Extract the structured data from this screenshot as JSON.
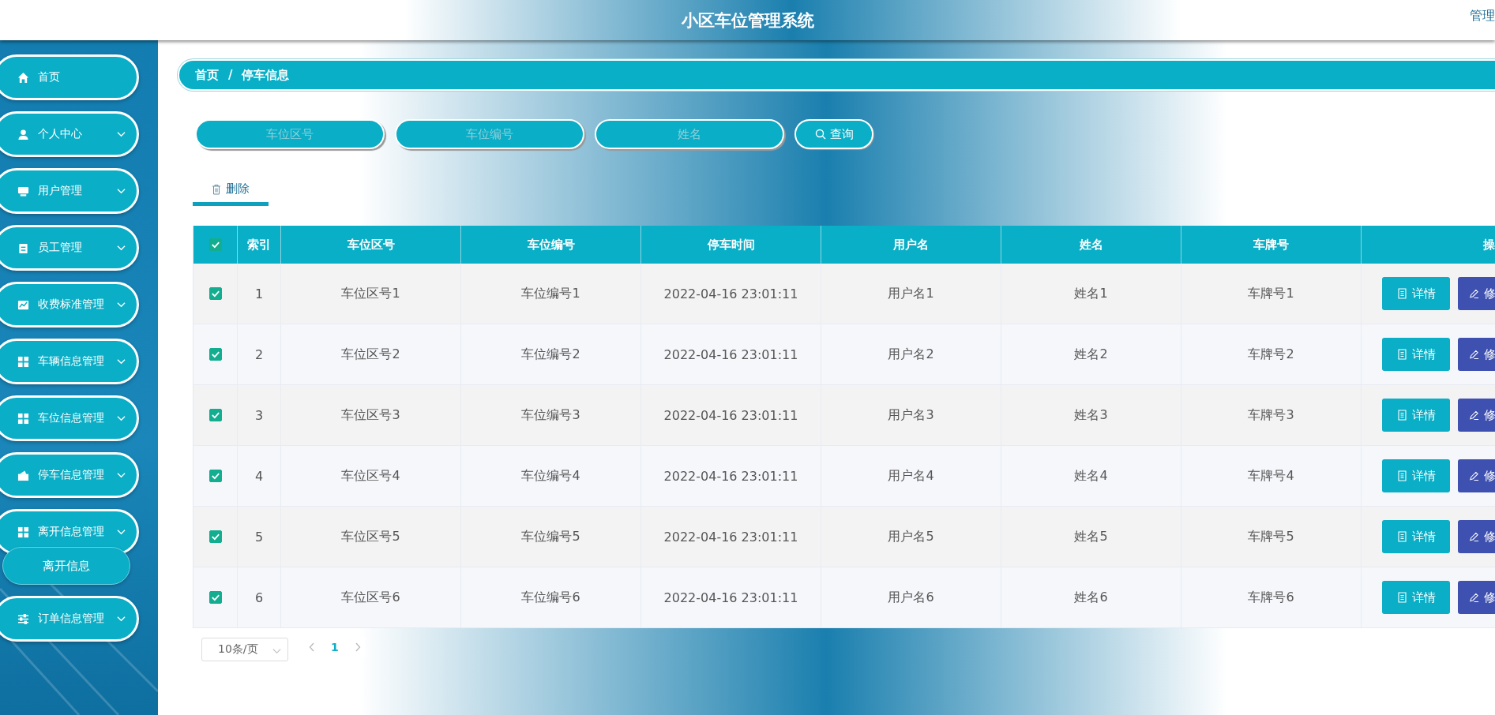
{
  "header": {
    "title": "小区车位管理系统",
    "user_menu": "管理"
  },
  "sidebar": {
    "items": [
      {
        "label": "首页",
        "kind": "link"
      },
      {
        "label": "个人中心",
        "kind": "group"
      },
      {
        "label": "用户管理",
        "kind": "group"
      },
      {
        "label": "员工管理",
        "kind": "group"
      },
      {
        "label": "收费标准管理",
        "kind": "group"
      },
      {
        "label": "车辆信息管理",
        "kind": "group"
      },
      {
        "label": "车位信息管理",
        "kind": "group"
      },
      {
        "label": "停车信息管理",
        "kind": "group"
      },
      {
        "label": "离开信息管理",
        "kind": "group",
        "children": [
          {
            "label": "离开信息"
          }
        ]
      },
      {
        "label": "订单信息管理",
        "kind": "group"
      }
    ]
  },
  "breadcrumb": [
    "首页",
    "停车信息"
  ],
  "breadcrumb_separator": "/",
  "search": {
    "fields": [
      {
        "placeholder": "车位区号"
      },
      {
        "placeholder": "车位编号"
      },
      {
        "placeholder": "姓名"
      }
    ],
    "button": "查询"
  },
  "tabs": [
    {
      "label": "删除",
      "selected": true
    }
  ],
  "table": {
    "all_checked": true,
    "columns": [
      "索引",
      "车位区号",
      "车位编号",
      "停车时间",
      "用户名",
      "姓名",
      "车牌号",
      "操"
    ],
    "rows": [
      {
        "checked": true,
        "cells": [
          "1",
          "车位区号1",
          "车位编号1",
          "2022-04-16 23:01:11",
          "用户名1",
          "姓名1",
          "车牌号1"
        ],
        "actions": [
          "详情",
          "修"
        ]
      },
      {
        "checked": true,
        "cells": [
          "2",
          "车位区号2",
          "车位编号2",
          "2022-04-16 23:01:11",
          "用户名2",
          "姓名2",
          "车牌号2"
        ],
        "actions": [
          "详情",
          "修"
        ]
      },
      {
        "checked": true,
        "cells": [
          "3",
          "车位区号3",
          "车位编号3",
          "2022-04-16 23:01:11",
          "用户名3",
          "姓名3",
          "车牌号3"
        ],
        "actions": [
          "详情",
          "修"
        ]
      },
      {
        "checked": true,
        "cells": [
          "4",
          "车位区号4",
          "车位编号4",
          "2022-04-16 23:01:11",
          "用户名4",
          "姓名4",
          "车牌号4"
        ],
        "actions": [
          "详情",
          "修"
        ]
      },
      {
        "checked": true,
        "cells": [
          "5",
          "车位区号5",
          "车位编号5",
          "2022-04-16 23:01:11",
          "用户名5",
          "姓名5",
          "车牌号5"
        ],
        "actions": [
          "详情",
          "修"
        ]
      },
      {
        "checked": true,
        "cells": [
          "6",
          "车位区号6",
          "车位编号6",
          "2022-04-16 23:01:11",
          "用户名6",
          "姓名6",
          "车牌号6"
        ],
        "actions": [
          "详情",
          "修"
        ]
      }
    ]
  },
  "pagination": {
    "page_size": "10条/页",
    "pages": [
      {
        "label": "1",
        "selected": true
      }
    ]
  }
}
